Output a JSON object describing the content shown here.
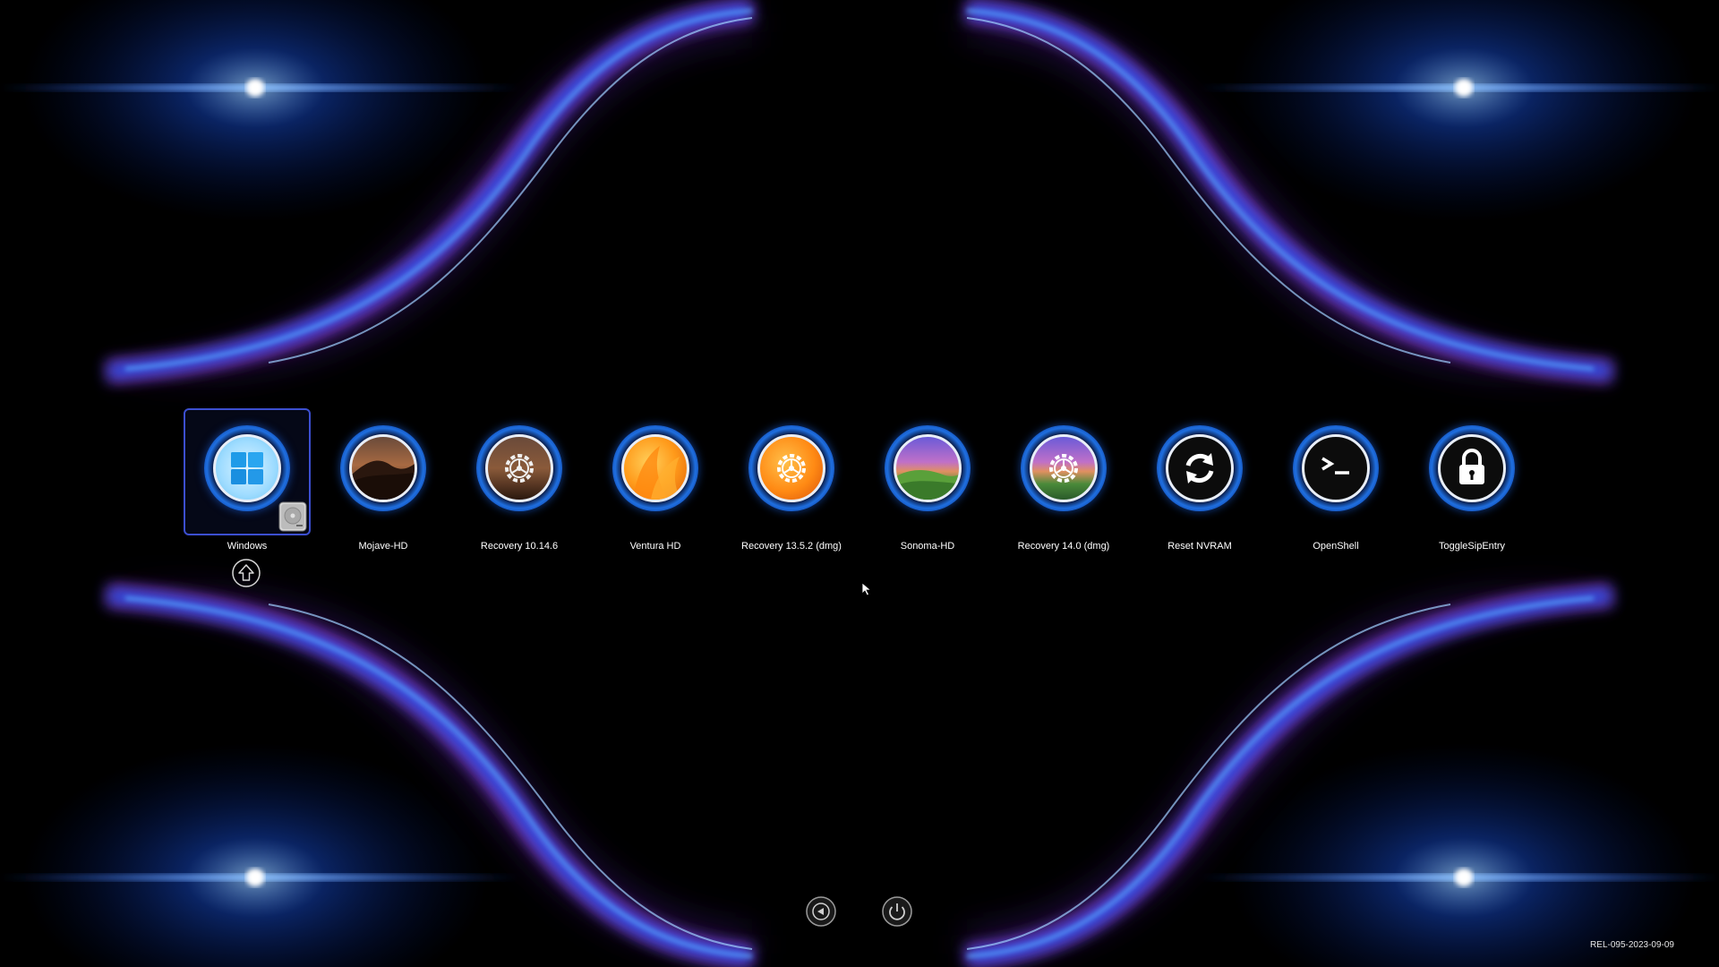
{
  "boot_picker": {
    "entries": [
      {
        "label": "Windows",
        "icon": "windows-logo-icon",
        "selected": true,
        "badge": "hard-drive-icon"
      },
      {
        "label": "Mojave-HD",
        "icon": "mojave-desert-icon",
        "selected": false
      },
      {
        "label": "Recovery 10.14.6",
        "icon": "recovery-gear-icon",
        "selected": false
      },
      {
        "label": "Ventura HD",
        "icon": "ventura-orange-icon",
        "selected": false
      },
      {
        "label": "Recovery 13.5.2 (dmg)",
        "icon": "recovery-gear-icon",
        "selected": false
      },
      {
        "label": "Sonoma-HD",
        "icon": "sonoma-hills-icon",
        "selected": false
      },
      {
        "label": "Recovery 14.0 (dmg)",
        "icon": "recovery-gear-icon",
        "selected": false
      },
      {
        "label": "Reset NVRAM",
        "icon": "reset-arrows-icon",
        "selected": false
      },
      {
        "label": "OpenShell",
        "icon": "terminal-prompt-icon",
        "selected": false
      },
      {
        "label": "ToggleSipEntry",
        "icon": "padlock-icon",
        "selected": false
      }
    ],
    "shift_indicator_icon": "shift-arrow-icon",
    "toolbar": {
      "back_icon": "restart-triangle-icon",
      "power_icon": "power-icon"
    },
    "version": "REL-095-2023-09-09"
  },
  "colors": {
    "accent_blue": "#1f6fe0",
    "glow_pink": "#e02ad0",
    "selection_border": "#3c4fd0",
    "text": "#ffffff"
  }
}
